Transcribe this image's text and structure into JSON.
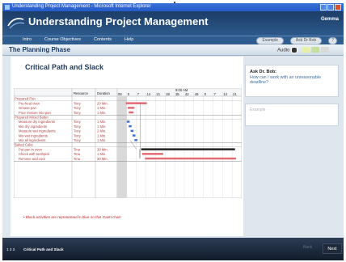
{
  "window": {
    "title": "Understanding Project Management - Microsoft Internet Explorer"
  },
  "app": {
    "title": "Understanding Project Management",
    "user": "Gemma"
  },
  "menu": [
    "Intro",
    "Course Objectives",
    "Contents",
    "Help"
  ],
  "toolbar": {
    "pill1": "Example",
    "pill2": "Ask Dr Bob",
    "pill3": "?"
  },
  "section": {
    "title": "The Planning Phase",
    "audio": "Audio"
  },
  "page": {
    "heading": "Critical Path and Slack",
    "note": "• Black activities are represented in blue on this Gantt chart"
  },
  "gantt": {
    "time_header": "9:00 AM",
    "ticks": [
      "08",
      "0",
      "7",
      "14",
      "21",
      "28",
      "35",
      "42",
      "49",
      "0",
      "7",
      "14",
      "21"
    ],
    "columns": {
      "resource": "Resource",
      "duration": "Duration"
    },
    "groups": [
      {
        "name": "Prepared Pan",
        "tasks": [
          {
            "name": "Pre-heat oven",
            "resource": "Tony",
            "duration": "20 Min."
          },
          {
            "name": "Grease pan",
            "resource": "Tony",
            "duration": "1 Min."
          },
          {
            "name": "Pour mixture into pan",
            "resource": "Tony",
            "duration": "1 Min."
          }
        ]
      },
      {
        "name": "Prepared Mixed Batter",
        "tasks": [
          {
            "name": "Measure dry ingredients",
            "resource": "Tony",
            "duration": "1 Min."
          },
          {
            "name": "Mix dry ingredients",
            "resource": "Tony",
            "duration": "1 Min."
          },
          {
            "name": "Measure wet ingredients",
            "resource": "Tony",
            "duration": "2 Min."
          },
          {
            "name": "Mix wet ingredients",
            "resource": "Tony",
            "duration": "1 Min."
          },
          {
            "name": "Mix all ingredients",
            "resource": "Tony",
            "duration": "1 Min."
          }
        ]
      },
      {
        "name": "Baked Cake",
        "tasks": [
          {
            "name": "Put pan in oven",
            "resource": "Tina",
            "duration": "30 Min."
          },
          {
            "name": "Check with toothpick",
            "resource": "Tina",
            "duration": "1 Min."
          },
          {
            "name": "Remove and cool",
            "resource": "Tina",
            "duration": "30 Min."
          }
        ]
      }
    ]
  },
  "sidebar": {
    "ask_title": "Ask Dr. Bob:",
    "ask_question": "How can I work with an unreasonable deadline?",
    "example": "Example"
  },
  "footer": {
    "pages": "1  2  3",
    "title": "Critical Path and Slack",
    "back": "Back",
    "next": "Next"
  },
  "colors": {
    "critical": "#e46b76",
    "slack": "#3b6fd8",
    "header": "#1c3d67"
  }
}
